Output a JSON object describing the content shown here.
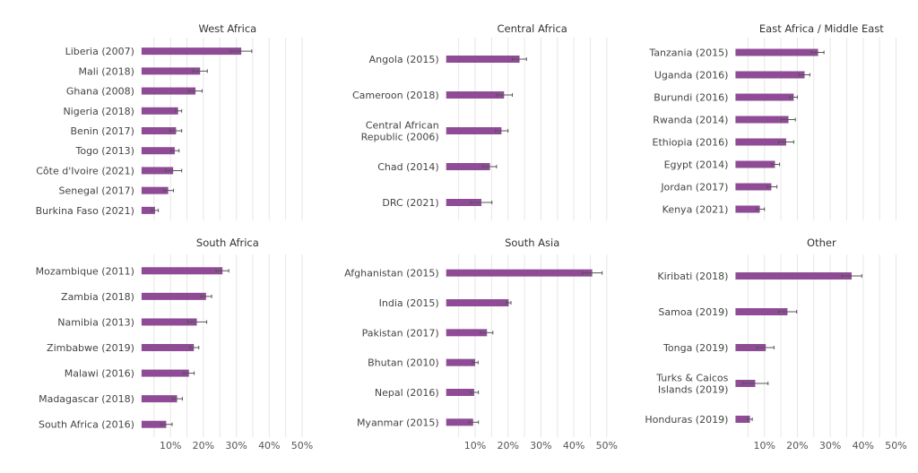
{
  "chart_data": [
    {
      "type": "bar",
      "orientation": "horizontal",
      "title": "West Africa",
      "categories": [
        "Liberia (2007)",
        "Mali (2018)",
        "Ghana (2008)",
        "Nigeria (2018)",
        "Benin (2017)",
        "Togo (2013)",
        "Côte d'Ivoire (2021)",
        "Senegal (2017)",
        "Burkina Faso (2021)"
      ],
      "values": [
        31.5,
        19.0,
        17.6,
        12.3,
        11.7,
        11.3,
        10.8,
        9.3,
        5.3
      ],
      "error_low": [
        28.2,
        16.8,
        15.5,
        11.5,
        9.8,
        10.1,
        8.5,
        8.0,
        4.2
      ],
      "error_high": [
        34.7,
        21.2,
        19.6,
        13.4,
        13.4,
        12.6,
        13.4,
        10.9,
        6.3
      ],
      "xlim": [
        1.2,
        53.5
      ],
      "tick_labels": [],
      "grid": true
    },
    {
      "type": "bar",
      "orientation": "horizontal",
      "title": "Central Africa",
      "categories": [
        "Angola (2015)",
        "Cameroon (2018)",
        "Central African\nRepublic (2006)",
        "Chad (2014)",
        "DRC (2021)"
      ],
      "values": [
        23.5,
        18.8,
        18.0,
        14.5,
        11.9
      ],
      "error_low": [
        21.3,
        16.5,
        16.2,
        12.4,
        8.6
      ],
      "error_high": [
        25.6,
        21.3,
        20.0,
        16.5,
        15.1
      ],
      "xlim": [
        1.2,
        53.5
      ],
      "tick_labels": [],
      "grid": true
    },
    {
      "type": "bar",
      "orientation": "horizontal",
      "title": "East Africa / Middle East",
      "categories": [
        "Tanzania (2015)",
        "Uganda (2016)",
        "Burundi (2016)",
        "Rwanda (2014)",
        "Ethiopia (2016)",
        "Egypt (2014)",
        "Jordan (2017)",
        "Kenya (2021)"
      ],
      "values": [
        26.3,
        22.2,
        18.9,
        17.3,
        16.6,
        13.2,
        12.1,
        8.6
      ],
      "error_low": [
        24.3,
        20.5,
        17.6,
        15.1,
        14.3,
        12.2,
        10.8,
        7.6
      ],
      "error_high": [
        28.1,
        23.8,
        20.0,
        19.4,
        18.9,
        14.6,
        13.8,
        10.0
      ],
      "xlim": [
        1.2,
        53.5
      ],
      "tick_labels": [],
      "grid": true
    },
    {
      "type": "bar",
      "orientation": "horizontal",
      "title": "South Africa",
      "categories": [
        "Mozambique (2011)",
        "Zambia (2018)",
        "Namibia (2013)",
        "Zimbabwe (2019)",
        "Malawi (2016)",
        "Madagascar (2018)",
        "South Africa (2016)"
      ],
      "values": [
        25.8,
        20.8,
        18.0,
        17.1,
        15.6,
        12.0,
        8.7
      ],
      "error_low": [
        23.8,
        19.2,
        15.2,
        15.9,
        14.0,
        10.7,
        7.2
      ],
      "error_high": [
        27.7,
        22.5,
        21.0,
        18.6,
        17.2,
        13.6,
        10.5
      ],
      "xlim": [
        1.2,
        53.5
      ],
      "tick_labels": [
        "10%",
        "20%",
        "30%",
        "40%",
        "50%"
      ],
      "grid": true
    },
    {
      "type": "bar",
      "orientation": "horizontal",
      "title": "South Asia",
      "categories": [
        "Afghanistan (2015)",
        "India (2015)",
        "Pakistan (2017)",
        "Bhutan (2010)",
        "Nepal (2016)",
        "Myanmar (2015)"
      ],
      "values": [
        45.6,
        20.2,
        13.6,
        10.0,
        9.7,
        9.4
      ],
      "error_low": [
        42.5,
        19.5,
        11.6,
        9.1,
        8.5,
        8.1
      ],
      "error_high": [
        48.6,
        20.9,
        15.4,
        10.9,
        11.0,
        11.0
      ],
      "xlim": [
        1.2,
        53.5
      ],
      "tick_labels": [
        "10%",
        "20%",
        "30%",
        "40%",
        "50%"
      ],
      "grid": true
    },
    {
      "type": "bar",
      "orientation": "horizontal",
      "title": "Other",
      "categories": [
        "Kiribati (2018)",
        "Samoa (2019)",
        "Tonga (2019)",
        "Turks & Caicos\nIslands (2019)",
        "Honduras (2019)"
      ],
      "values": [
        36.5,
        17.0,
        10.4,
        7.2,
        5.6
      ],
      "error_low": [
        33.6,
        14.3,
        7.7,
        3.4,
        4.9
      ],
      "error_high": [
        39.6,
        19.8,
        12.9,
        11.1,
        6.3
      ],
      "xlim": [
        1.2,
        53.5
      ],
      "tick_labels": [
        "10%",
        "20%",
        "30%",
        "40%",
        "50%"
      ],
      "grid": true
    }
  ],
  "colors": {
    "bar": "#8f4b96",
    "error_bar": "#555555",
    "grid": "#e6e6e6"
  }
}
